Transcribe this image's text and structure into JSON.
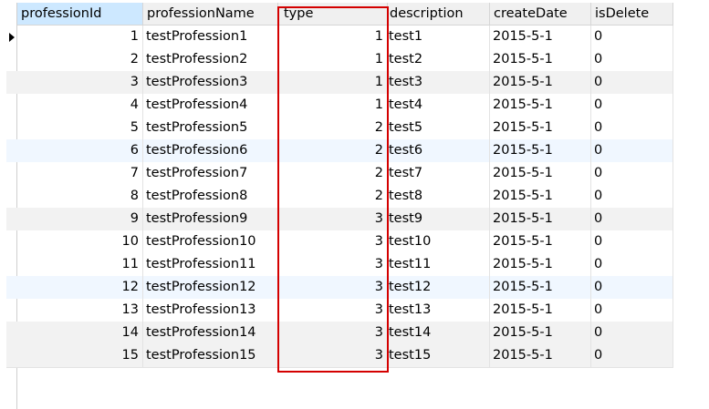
{
  "columns": [
    "professionId",
    "professionName",
    "type",
    "description",
    "createDate",
    "isDelete"
  ],
  "rows": [
    [
      "1",
      "testProfession1",
      "1",
      "test1",
      "2015-5-1",
      "0"
    ],
    [
      "2",
      "testProfession2",
      "1",
      "test2",
      "2015-5-1",
      "0"
    ],
    [
      "3",
      "testProfession3",
      "1",
      "test3",
      "2015-5-1",
      "0"
    ],
    [
      "4",
      "testProfession4",
      "1",
      "test4",
      "2015-5-1",
      "0"
    ],
    [
      "5",
      "testProfession5",
      "2",
      "test5",
      "2015-5-1",
      "0"
    ],
    [
      "6",
      "testProfession6",
      "2",
      "test6",
      "2015-5-1",
      "0"
    ],
    [
      "7",
      "testProfession7",
      "2",
      "test7",
      "2015-5-1",
      "0"
    ],
    [
      "8",
      "testProfession8",
      "2",
      "test8",
      "2015-5-1",
      "0"
    ],
    [
      "9",
      "testProfession9",
      "3",
      "test9",
      "2015-5-1",
      "0"
    ],
    [
      "10",
      "testProfession10",
      "3",
      "test10",
      "2015-5-1",
      "0"
    ],
    [
      "11",
      "testProfession11",
      "3",
      "test11",
      "2015-5-1",
      "0"
    ],
    [
      "12",
      "testProfession12",
      "3",
      "test12",
      "2015-5-1",
      "0"
    ],
    [
      "13",
      "testProfession13",
      "3",
      "test13",
      "2015-5-1",
      "0"
    ],
    [
      "14",
      "testProfession14",
      "3",
      "test14",
      "2015-5-1",
      "0"
    ],
    [
      "15",
      "testProfession15",
      "3",
      "test15",
      "2015-5-1",
      "0"
    ]
  ],
  "current_row_indicator": "triangle-right-icon",
  "highlighted_column": "type",
  "highlight_color": "#d40000",
  "selected_header_color": "#cde8ff"
}
